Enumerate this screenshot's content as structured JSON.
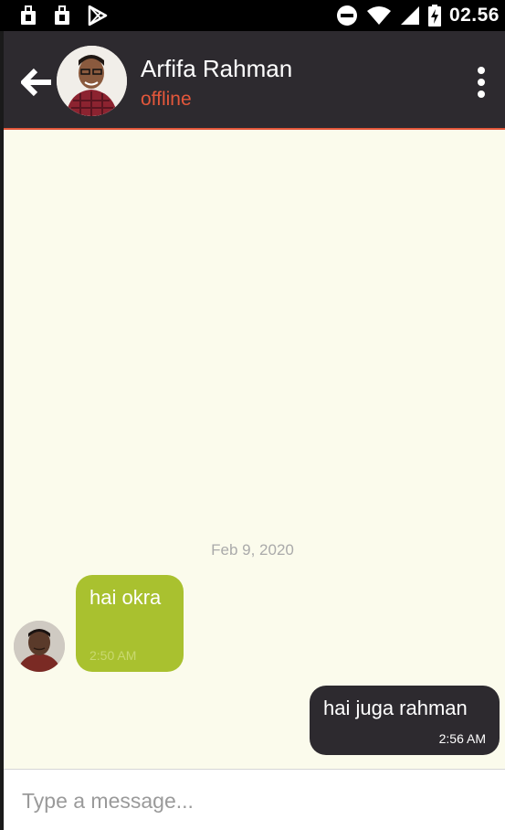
{
  "status_bar": {
    "time": "02.56",
    "left_icons": [
      "usb-bag-icon",
      "usb-bag-icon",
      "play-store-icon"
    ],
    "right_icons": [
      "do-not-disturb-icon",
      "wifi-icon",
      "cell-signal-icon",
      "battery-charging-icon"
    ]
  },
  "header": {
    "contact_name": "Arfifa Rahman",
    "contact_status": "offline",
    "back_icon": "arrow-left-icon",
    "menu_icon": "more-vertical-icon"
  },
  "chat": {
    "date_separator": "Feb 9, 2020",
    "messages": [
      {
        "direction": "incoming",
        "text": "hai okra",
        "time": "2:50 AM"
      },
      {
        "direction": "outgoing",
        "text": "hai juga rahman",
        "time": "2:56 AM"
      }
    ]
  },
  "composer": {
    "placeholder": "Type a message...",
    "value": ""
  },
  "colors": {
    "app_bar": "#2d2a2f",
    "accent": "#e3573b",
    "incoming_bubble": "#a9c12f",
    "outgoing_bubble": "#2d2a2f",
    "chat_background": "#fbfbec"
  }
}
